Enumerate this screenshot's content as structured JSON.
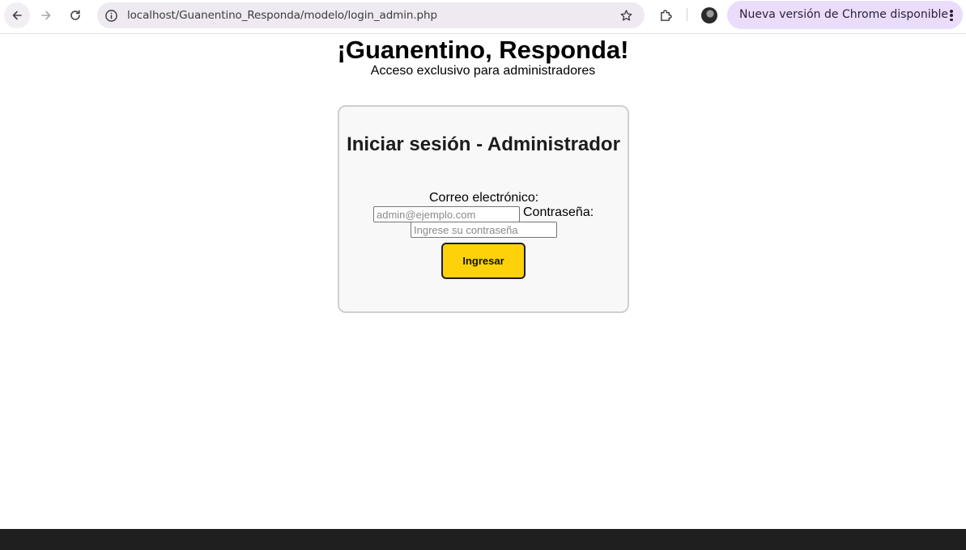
{
  "browser": {
    "url": "localhost/Guanentino_Responda/modelo/login_admin.php",
    "update_label": "Nueva versión de Chrome disponible"
  },
  "header": {
    "title": "¡Guanentino, Responda!",
    "subtitle": "Acceso exclusivo para administradores"
  },
  "login": {
    "title": "Iniciar sesión - Administrador",
    "email_label": "Correo electrónico:",
    "email_placeholder": "admin@ejemplo.com",
    "password_label": "Contraseña:",
    "password_placeholder": "Ingrese su contraseña",
    "submit_label": "Ingresar"
  },
  "colors": {
    "submit_button": "#fdd20a",
    "card_background": "#f8f8f8",
    "update_pill": "#e9ddfb"
  }
}
